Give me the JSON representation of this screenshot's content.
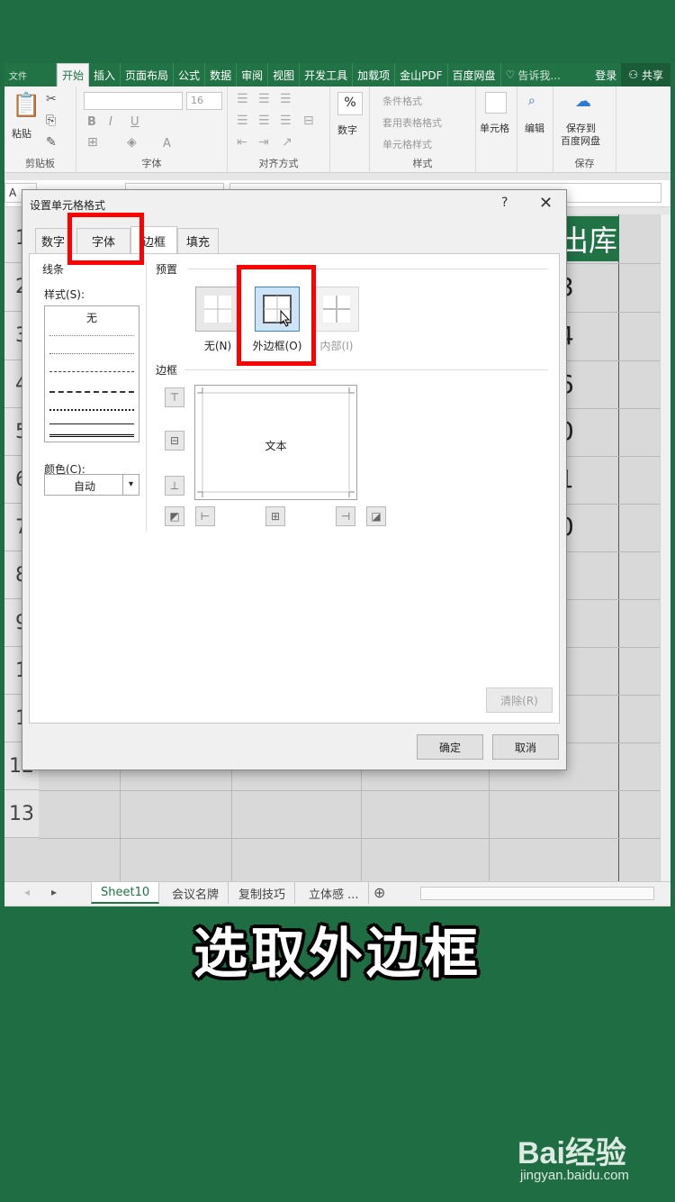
{
  "ribbon_tabs": [
    "文件",
    "开始",
    "插入",
    "页面布局",
    "公式",
    "数据",
    "审阅",
    "视图",
    "开发工具",
    "加载项",
    "金山PDF",
    "百度网盘"
  ],
  "tell_me": "告诉我...",
  "login": "登录",
  "share": "共享",
  "ribbon": {
    "clipboard": {
      "paste": "粘贴",
      "label": "剪贴板"
    },
    "font": {
      "size": "16",
      "bold": "B",
      "italic": "I",
      "underline": "U",
      "font_color": "A",
      "label": "字体"
    },
    "alignment": {
      "label": "对齐方式"
    },
    "number": {
      "percent": "%",
      "name": "数字"
    },
    "styles": {
      "conditional": "条件格式",
      "table": "套用表格格式",
      "cell_style": "单元格样式",
      "label": "样式"
    },
    "cells": {
      "name": "单元格"
    },
    "editing": {
      "name": "编辑"
    },
    "save": {
      "line1": "保存到",
      "line2": "百度网盘",
      "label": "保存"
    }
  },
  "namebox": "A",
  "row_numbers": [
    "1",
    "2",
    "3",
    "4",
    "5",
    "6",
    "7",
    "8",
    "9",
    "1",
    "1",
    "12",
    "13"
  ],
  "sheet": {
    "header_cell": "出库",
    "digits": [
      "3",
      "4",
      "6",
      "0",
      "1",
      "0"
    ]
  },
  "sheet_tabs": [
    "Sheet10",
    "会议名牌",
    "复制技巧",
    "立体感 ..."
  ],
  "dialog": {
    "title": "设置单元格格式",
    "help": "?",
    "close": "✕",
    "tabs": [
      "数字",
      "字体",
      "边框",
      "填充"
    ],
    "line_section": "线条",
    "style_label": "样式(S):",
    "style_none": "无",
    "color_label": "颜色(C):",
    "color_value": "自动",
    "preset_section": "预置",
    "presets": [
      "无(N)",
      "外边框(O)",
      "内部(I)"
    ],
    "border_section": "边框",
    "preview_text": "文本",
    "clear_button": "清除(R)",
    "ok_button": "确定",
    "cancel_button": "取消"
  },
  "caption": "选取外边框",
  "watermark": {
    "logo": "Bai经验",
    "url": "jingyan.baidu.com"
  },
  "colors": {
    "excel_green": "#217346",
    "highlight": "#ff0000",
    "selected_preset": "#cfe3f6"
  }
}
